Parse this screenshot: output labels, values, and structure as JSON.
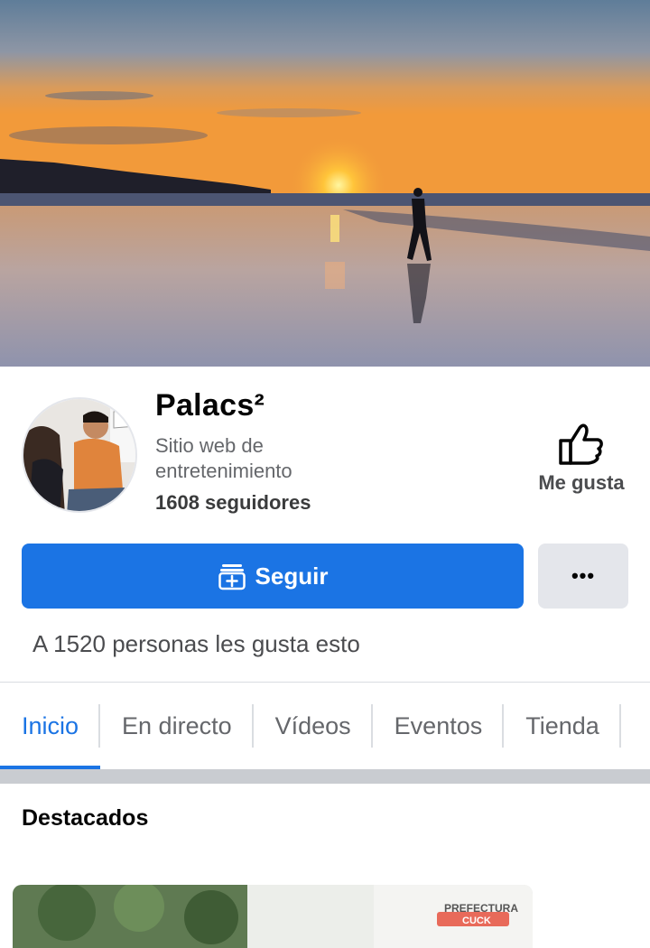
{
  "page": {
    "name": "Palacs²",
    "category": "Sitio web de entretenimiento",
    "followers": "1608 seguidores",
    "likes_summary": "A 1520 personas les gusta esto"
  },
  "actions": {
    "like_label": "Me gusta",
    "follow_label": "Seguir",
    "more_label": "•••"
  },
  "tabs": [
    {
      "label": "Inicio",
      "active": true
    },
    {
      "label": "En directo",
      "active": false
    },
    {
      "label": "Vídeos",
      "active": false
    },
    {
      "label": "Eventos",
      "active": false
    },
    {
      "label": "Tienda",
      "active": false
    }
  ],
  "featured": {
    "title": "Destacados",
    "card_sign_text": "PREFECTURA",
    "card_sign_text_2": "CUCK"
  },
  "colors": {
    "accent": "#1b74e4",
    "secondary_button": "#e4e6eb",
    "muted_text": "#65676b"
  },
  "icons": {
    "like": "thumbs-up-icon",
    "follow": "follow-plus-icon",
    "more": "more-dots-icon"
  }
}
